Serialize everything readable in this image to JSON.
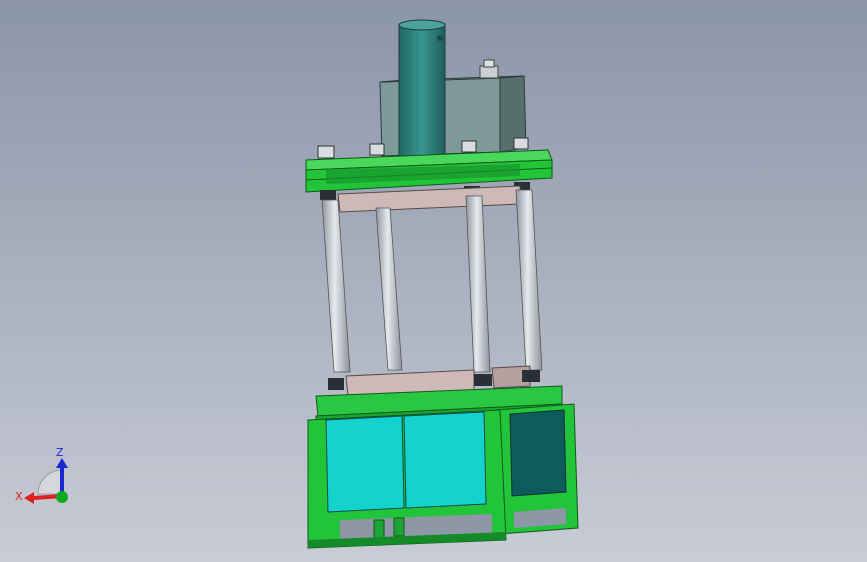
{
  "viewport": {
    "background_top": "#8b95a8",
    "background_bottom": "#c8ccd6"
  },
  "colors": {
    "frame_green": "#22c43a",
    "frame_green_dark": "#17932a",
    "panel_cyan": "#14d3cf",
    "panel_teal_dark": "#0e5b5b",
    "cylinder_teal": "#2e7f7b",
    "tank_gray": "#7d9a98",
    "column_gray": "#b9bfc8",
    "platen_pink": "#cdbab8"
  },
  "triad": {
    "x_label": "X",
    "z_label": "Z",
    "x_color": "#e02020",
    "z_color": "#1a2ad0",
    "y_color": "#11a820"
  }
}
